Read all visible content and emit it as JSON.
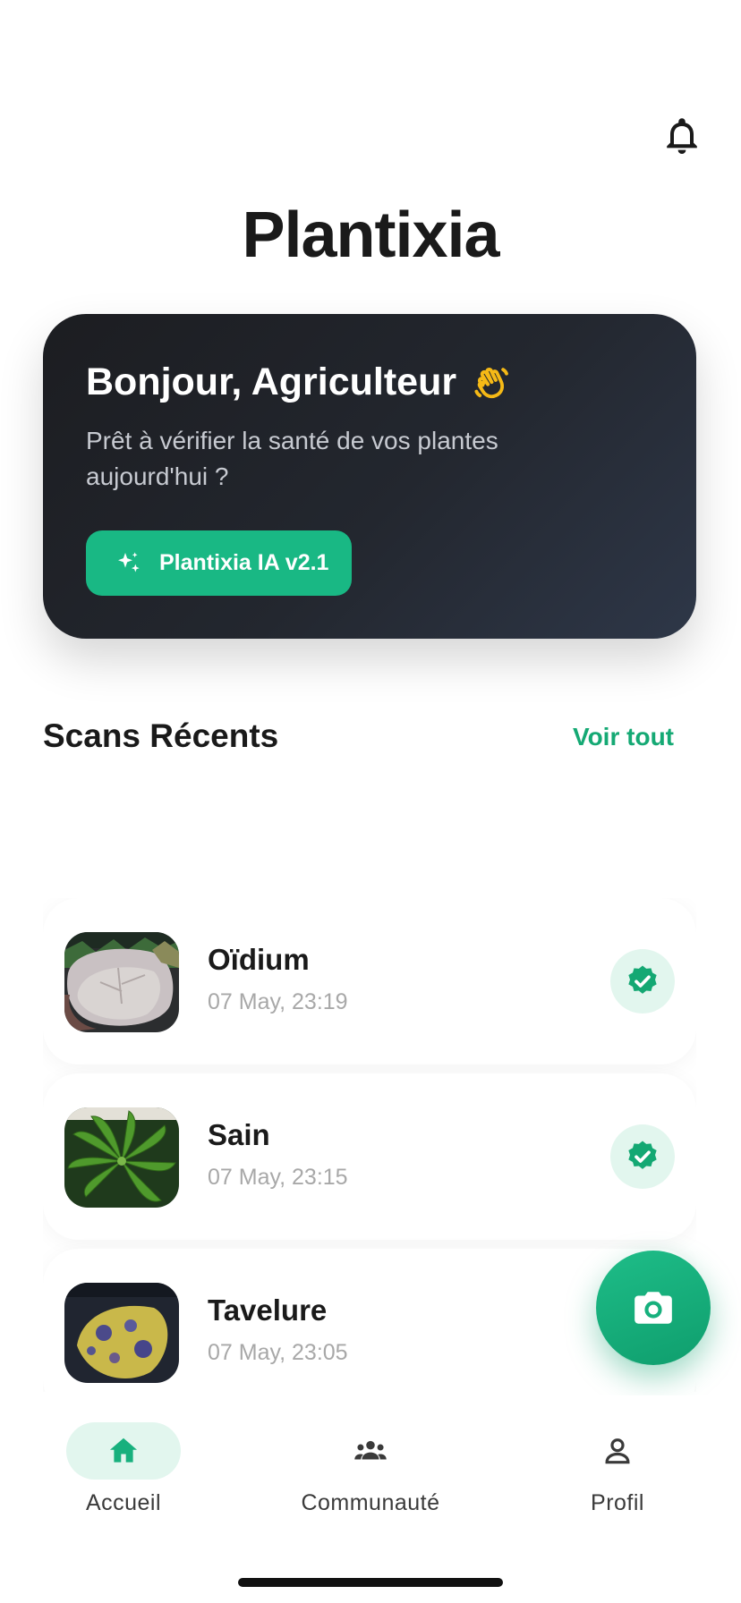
{
  "app_title": "Plantixia",
  "hero": {
    "greeting": "Bonjour, Agriculteur",
    "subtitle": "Prêt à vérifier la santé de vos plantes aujourd'hui ?",
    "ai_button_label": "Plantixia IA v2.1"
  },
  "recent": {
    "title": "Scans Récents",
    "see_all": "Voir tout",
    "items": [
      {
        "name": "Oïdium",
        "date": "07 May, 23:19",
        "thumbnail": "powdery-mildew-leaf",
        "status": "verified"
      },
      {
        "name": "Sain",
        "date": "07 May, 23:15",
        "thumbnail": "healthy-leaf",
        "status": "verified"
      },
      {
        "name": "Tavelure",
        "date": "07 May, 23:05",
        "thumbnail": "scab-leaf",
        "status": "verified"
      }
    ]
  },
  "nav": {
    "items": [
      {
        "label": "Accueil",
        "icon": "home-icon",
        "active": true
      },
      {
        "label": "Communauté",
        "icon": "group-icon",
        "active": false
      },
      {
        "label": "Profil",
        "icon": "person-icon",
        "active": false
      }
    ]
  },
  "colors": {
    "accent": "#19b884",
    "accent_light": "#e2f6ee",
    "hero_bg": "#1c1d21",
    "text": "#1a1a1a",
    "muted": "#a8a8a8"
  }
}
